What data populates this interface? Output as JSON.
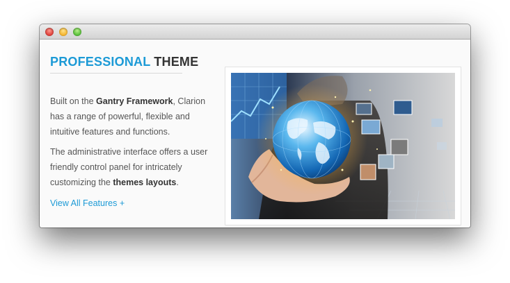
{
  "window": {
    "controls": [
      "close",
      "minimize",
      "maximize"
    ]
  },
  "section": {
    "heading_accent": "PROFESSIONAL",
    "heading_rest": "THEME",
    "para1": {
      "pre": "Built on the ",
      "bold": "Gantry Framework",
      "post": ", Clarion has a range of powerful, flexible and intuitive features and functions."
    },
    "para2": {
      "pre": "The administrative interface offers a user friendly control panel for intricately customizing the ",
      "bold": "themes layouts",
      "post": "."
    },
    "link_label": "View All Features +"
  },
  "image": {
    "subject": "businessman-hand-holding-glowing-globe"
  },
  "colors": {
    "accent": "#1c9ad6",
    "heading_text": "#333333",
    "body_text": "#555555"
  }
}
